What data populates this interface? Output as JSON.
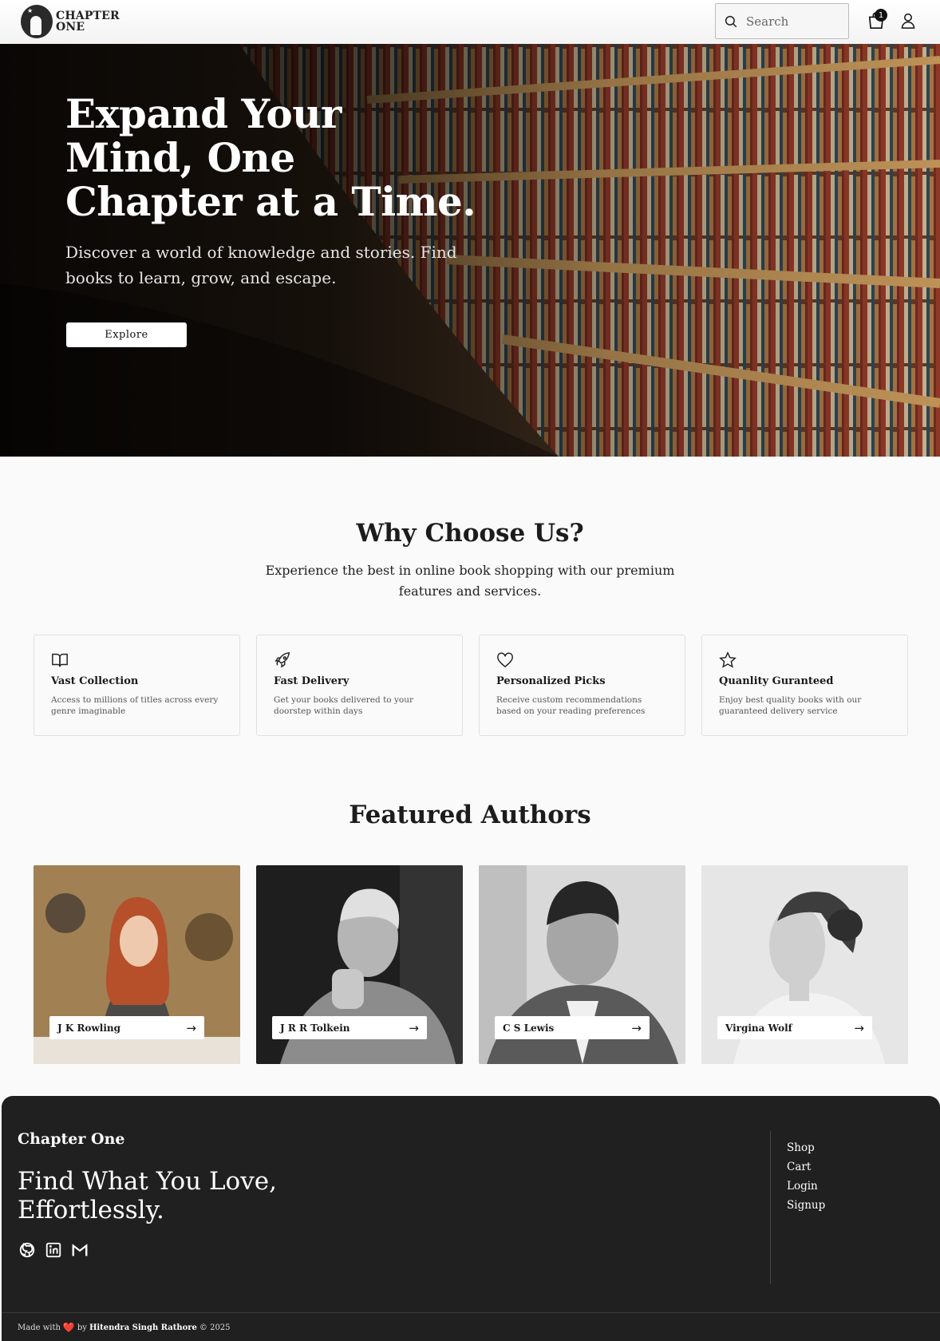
{
  "nav": {
    "logo_line1": "CHAPTER",
    "logo_line2": "ONE",
    "search_placeholder": "Search",
    "cart_count": "1",
    "icons": [
      "search-icon",
      "shopping-bag-icon",
      "user-icon"
    ]
  },
  "hero": {
    "title": "Expand Your Mind, One Chapter at a Time.",
    "subtitle": "Discover a world of knowledge and stories. Find books to learn, grow, and escape.",
    "cta_label": "Explore"
  },
  "why": {
    "title": "Why Choose Us?",
    "subtitle": "Experience the best in online book shopping with our premium features and services.",
    "features": [
      {
        "icon": "book-open-icon",
        "title": "Vast Collection",
        "desc": "Access to millions of titles across every genre imaginable"
      },
      {
        "icon": "rocket-icon",
        "title": "Fast Delivery",
        "desc": "Get your books delivered to your doorstep within days"
      },
      {
        "icon": "heart-icon",
        "title": "Personalized Picks",
        "desc": "Receive custom recommendations based on your reading preferences"
      },
      {
        "icon": "star-icon",
        "title": "Quanlity Guranteed",
        "desc": "Enjoy best quality books with our guaranteed delivery service"
      }
    ]
  },
  "authors": {
    "title": "Featured Authors",
    "items": [
      {
        "name": "J K Rowling",
        "arrow": "→"
      },
      {
        "name": "J R R Tolkein",
        "arrow": "→"
      },
      {
        "name": "C S Lewis",
        "arrow": "→"
      },
      {
        "name": "Virgina Wolf",
        "arrow": "→"
      }
    ]
  },
  "footer": {
    "brand": "Chapter One",
    "tagline": "Find What You Love, Effortlessly.",
    "socials": [
      "github-icon",
      "linkedin-icon",
      "gmail-icon"
    ],
    "links": [
      "Shop",
      "Cart",
      "Login",
      "Signup"
    ],
    "made_with": "Made with",
    "heart": "❤️",
    "by": "by",
    "author": "Hitendra Singh Rathore",
    "copyright": "© 2025"
  },
  "colors": {
    "footer_bg": "#202020",
    "page_bg": "#fafafa",
    "heart": "#e03131"
  }
}
